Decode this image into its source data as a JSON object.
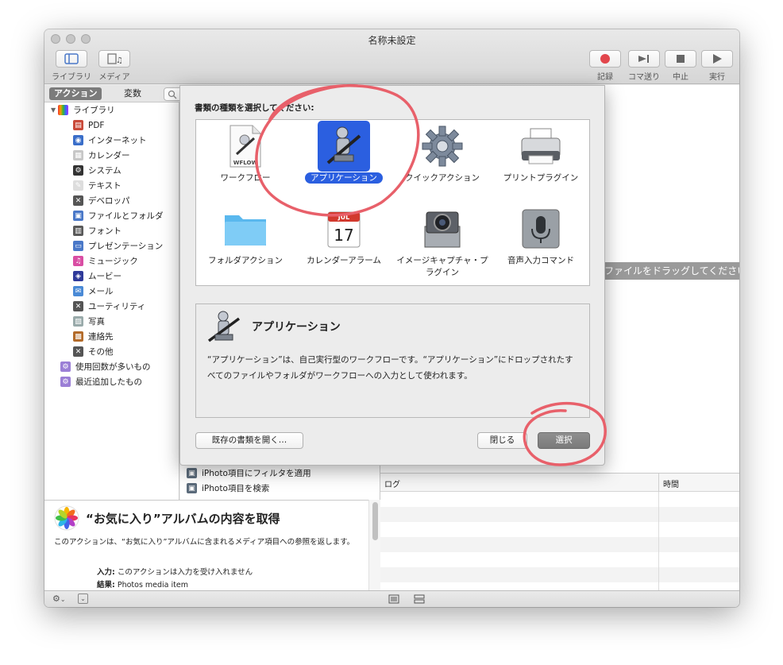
{
  "window": {
    "title": "名称未設定"
  },
  "toolbar": {
    "library_label": "ライブラリ",
    "media_label": "メディア",
    "record_label": "記録",
    "step_label": "コマ送り",
    "stop_label": "中止",
    "run_label": "実行"
  },
  "left_tabs": {
    "actions": "アクション",
    "variables": "変数"
  },
  "library": {
    "root": "ライブラリ",
    "items": [
      "PDF",
      "インターネット",
      "カレンダー",
      "システム",
      "テキスト",
      "デベロッパ",
      "ファイルとフォルダ",
      "フォント",
      "プレゼンテーション",
      "ミュージック",
      "ムービー",
      "メール",
      "ユーティリティ",
      "写真",
      "連絡先",
      "その他"
    ],
    "smart_groups": [
      "使用回数が多いもの",
      "最近追加したもの"
    ]
  },
  "actions_list": [
    "iPhoto項目にフィルタを適用",
    "iPhoto項目を検索"
  ],
  "action_description": {
    "title": "“お気に入り”アルバムの内容を取得",
    "body": "このアクションは、“お気に入り”アルバムに含まれるメディア項目への参照を返します。",
    "input_label": "入力:",
    "input_value": "このアクションは入力を受け入れません",
    "result_label": "結果:",
    "result_value": "Photos media item"
  },
  "workflow": {
    "drag_hint": "ファイルをドラッグしてください"
  },
  "log": {
    "col_log": "ログ",
    "col_time": "時間"
  },
  "dialog": {
    "prompt": "書類の種類を選択してください:",
    "types": [
      {
        "label": "ワークフロー",
        "icon": "workflow-icon"
      },
      {
        "label": "アプリケーション",
        "icon": "automator-robot-icon",
        "selected": true
      },
      {
        "label": "クイックアクション",
        "icon": "gear-icon"
      },
      {
        "label": "プリントプラグイン",
        "icon": "printer-icon"
      },
      {
        "label": "フォルダアクション",
        "icon": "folder-icon"
      },
      {
        "label": "カレンダーアラーム",
        "icon": "calendar-icon"
      },
      {
        "label": "イメージキャプチャ・プラグイン",
        "icon": "camera-icon"
      },
      {
        "label": "音声入力コマンド",
        "icon": "microphone-icon"
      }
    ],
    "workflow_badge": "WFLOW",
    "calendar_month": "JUL",
    "calendar_day": "17",
    "detail_title": "アプリケーション",
    "detail_text": "“アプリケーション”は、自己実行型のワークフローです。“アプリケーション”にドロップされたすべてのファイルやフォルダがワークフローへの入力として使われます。",
    "open_existing": "既存の書類を開く…",
    "close": "閉じる",
    "choose": "選択"
  },
  "colors": {
    "selection": "#2b5fe0",
    "annotation": "#e8606a",
    "default_button": "#7b7b7b"
  }
}
